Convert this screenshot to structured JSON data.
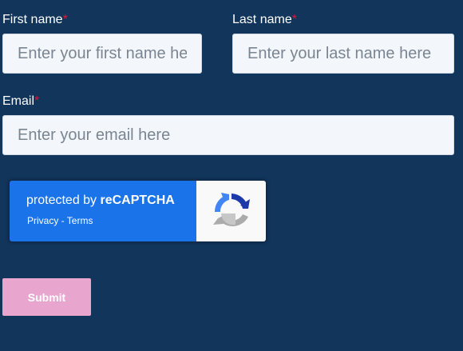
{
  "form": {
    "first_name": {
      "label": "First name",
      "required_mark": "*",
      "placeholder": "Enter your first name here",
      "value": ""
    },
    "last_name": {
      "label": "Last name",
      "required_mark": "*",
      "placeholder": "Enter your last name here",
      "value": ""
    },
    "email": {
      "label": "Email",
      "required_mark": "*",
      "placeholder": "Enter your email here",
      "value": ""
    },
    "recaptcha": {
      "prefix": "protected by ",
      "brand": "reCAPTCHA",
      "privacy": "Privacy",
      "separator": " - ",
      "terms": "Terms",
      "icon": "recaptcha-logo-icon"
    },
    "submit_label": "Submit"
  },
  "colors": {
    "background": "#12355b",
    "required": "#e0143c",
    "recaptcha_blue": "#1a73e8",
    "submit_bg": "#e8a6cf"
  }
}
